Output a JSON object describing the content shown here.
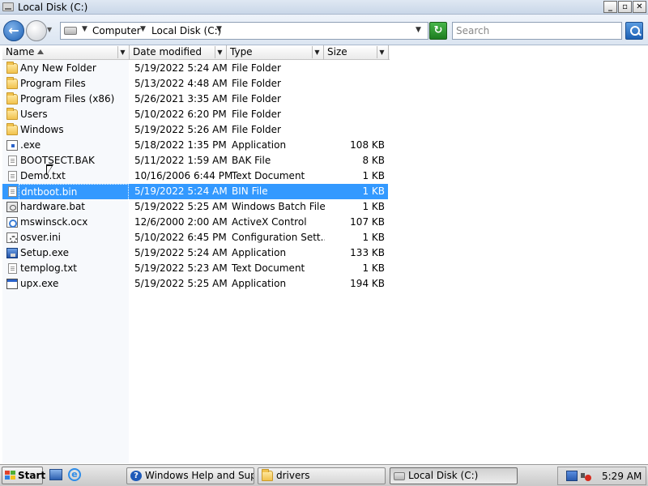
{
  "window": {
    "title": "Local Disk (C:)",
    "controls": {
      "minimize": "_",
      "maximize": "▫",
      "close": "✕"
    }
  },
  "nav": {
    "back_label": "←",
    "crumbs": [
      "Computer",
      "Local Disk (C:)"
    ],
    "refresh_label": "↻",
    "search_placeholder": "Search"
  },
  "columns": [
    "Name",
    "Date modified",
    "Type",
    "Size"
  ],
  "files": [
    {
      "name": "Any New Folder",
      "date": "5/19/2022 5:24 AM",
      "type": "File Folder",
      "size": "",
      "icon": "folder-icon",
      "selected": false
    },
    {
      "name": "Program Files",
      "date": "5/13/2022 4:48 AM",
      "type": "File Folder",
      "size": "",
      "icon": "folder-icon",
      "selected": false
    },
    {
      "name": "Program Files (x86)",
      "date": "5/26/2021 3:35 AM",
      "type": "File Folder",
      "size": "",
      "icon": "folder-icon",
      "selected": false
    },
    {
      "name": "Users",
      "date": "5/10/2022 6:20 PM",
      "type": "File Folder",
      "size": "",
      "icon": "folder-icon",
      "selected": false
    },
    {
      "name": "Windows",
      "date": "5/19/2022 5:26 AM",
      "type": "File Folder",
      "size": "",
      "icon": "folder-icon",
      "selected": false
    },
    {
      "name": ".exe",
      "date": "5/18/2022 1:35 PM",
      "type": "Application",
      "size": "108 KB",
      "icon": "executable-icon",
      "selected": false
    },
    {
      "name": "BOOTSECT.BAK",
      "date": "5/11/2022 1:59 AM",
      "type": "BAK File",
      "size": "8 KB",
      "icon": "document-icon",
      "selected": false
    },
    {
      "name": "Demo.txt",
      "date": "10/16/2006 6:44 PM",
      "type": "Text Document",
      "size": "1 KB",
      "icon": "text-document-icon",
      "selected": false
    },
    {
      "name": "dntboot.bin",
      "date": "5/19/2022 5:24 AM",
      "type": "BIN File",
      "size": "1 KB",
      "icon": "document-icon",
      "selected": true
    },
    {
      "name": "hardware.bat",
      "date": "5/19/2022 5:25 AM",
      "type": "Windows Batch File",
      "size": "1 KB",
      "icon": "batch-file-icon",
      "selected": false
    },
    {
      "name": "mswinsck.ocx",
      "date": "12/6/2000 2:00 AM",
      "type": "ActiveX Control",
      "size": "107 KB",
      "icon": "activex-icon",
      "selected": false
    },
    {
      "name": "osver.ini",
      "date": "5/10/2022 6:45 PM",
      "type": "Configuration Sett...",
      "size": "1 KB",
      "icon": "settings-file-icon",
      "selected": false
    },
    {
      "name": "Setup.exe",
      "date": "5/19/2022 5:24 AM",
      "type": "Application",
      "size": "133 KB",
      "icon": "setup-icon",
      "selected": false
    },
    {
      "name": "templog.txt",
      "date": "5/19/2022 5:23 AM",
      "type": "Text Document",
      "size": "1 KB",
      "icon": "text-document-icon",
      "selected": false
    },
    {
      "name": "upx.exe",
      "date": "5/19/2022 5:25 AM",
      "type": "Application",
      "size": "194 KB",
      "icon": "application-icon",
      "selected": false
    }
  ],
  "taskbar": {
    "start_label": "Start",
    "tasks": [
      {
        "label": "Windows Help and Sup...",
        "icon": "help-icon",
        "active": false
      },
      {
        "label": "drivers",
        "icon": "folder-icon",
        "active": false
      },
      {
        "label": "Local Disk (C:)",
        "icon": "drive-icon",
        "active": true
      }
    ],
    "clock": "5:29 AM"
  },
  "colors": {
    "selection": "#3399ff",
    "titlebar": "#dfe8f3",
    "taskbar": "#d6d6d6"
  }
}
